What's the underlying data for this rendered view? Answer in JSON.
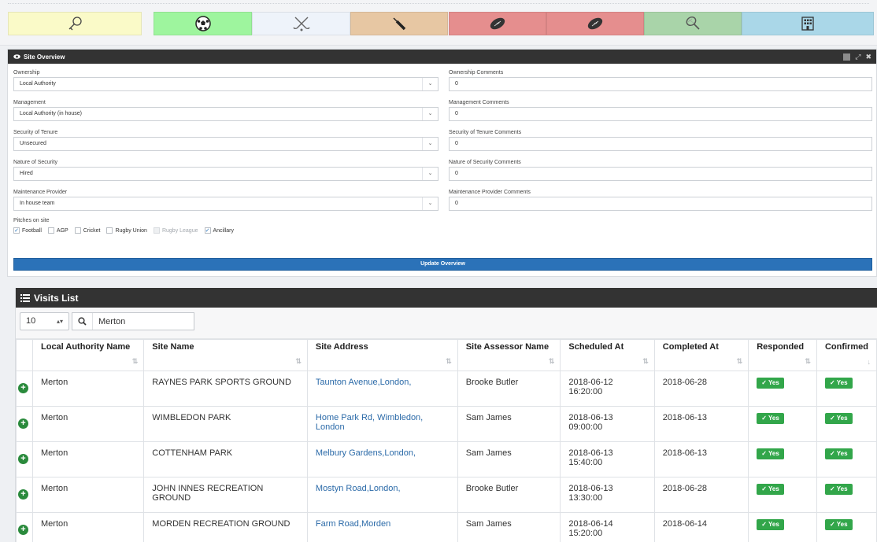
{
  "sport_tiles": [
    {
      "icon": "key-icon",
      "color": "#fafac8"
    },
    {
      "icon": "football-icon",
      "color": "#9ef59e"
    },
    {
      "icon": "hockey-sticks-icon",
      "color": "#eef3fa"
    },
    {
      "icon": "cricket-bat-icon",
      "color": "#e7c7a3"
    },
    {
      "icon": "rugby-ball-icon",
      "color": "#e58e8e"
    },
    {
      "icon": "rugby-ball-icon",
      "color": "#e58e8e"
    },
    {
      "icon": "tennis-racket-icon",
      "color": "#a9d4a9"
    },
    {
      "icon": "building-icon",
      "color": "#aad7e8"
    }
  ],
  "overview": {
    "title": "Site Overview",
    "left_fields": [
      {
        "label": "Ownership",
        "value": "Local Authority"
      },
      {
        "label": "Management",
        "value": "Local Authority (in house)"
      },
      {
        "label": "Security of Tenure",
        "value": "Unsecured"
      },
      {
        "label": "Nature of Security",
        "value": "Hired"
      },
      {
        "label": "Maintenance Provider",
        "value": "In house team"
      }
    ],
    "right_fields": [
      {
        "label": "Ownership Comments",
        "value": "0"
      },
      {
        "label": "Management Comments",
        "value": "0"
      },
      {
        "label": "Security of Tenure Comments",
        "value": "0"
      },
      {
        "label": "Nature of Security Comments",
        "value": "0"
      },
      {
        "label": "Maintenance Provider Comments",
        "value": "0"
      }
    ],
    "pitches_label": "Pitches on site",
    "pitches": [
      {
        "label": "Football",
        "checked": true,
        "disabled": false
      },
      {
        "label": "AGP",
        "checked": false,
        "disabled": false
      },
      {
        "label": "Cricket",
        "checked": false,
        "disabled": false
      },
      {
        "label": "Rugby Union",
        "checked": false,
        "disabled": false
      },
      {
        "label": "Rugby League",
        "checked": false,
        "disabled": true
      },
      {
        "label": "Ancillary",
        "checked": true,
        "disabled": false
      }
    ],
    "update_label": "Update Overview"
  },
  "visits": {
    "title": "Visits List",
    "page_size": "10",
    "search_value": "Merton",
    "columns": [
      "Local Authority Name",
      "Site Name",
      "Site Address",
      "Site Assessor Name",
      "Scheduled At",
      "Completed At",
      "Responded",
      "Confirmed"
    ],
    "rows": [
      [
        "Merton",
        "RAYNES PARK SPORTS GROUND",
        "Taunton Avenue,London,",
        "Brooke Butler",
        "2018-06-12 16:20:00",
        "2018-06-28",
        "✓ Yes",
        "✓ Yes"
      ],
      [
        "Merton",
        "WIMBLEDON PARK",
        "Home Park Rd, Wimbledon, London",
        "Sam James",
        "2018-06-13 09:00:00",
        "2018-06-13",
        "✓ Yes",
        "✓ Yes"
      ],
      [
        "Merton",
        "COTTENHAM PARK",
        "Melbury Gardens,London,",
        "Sam James",
        "2018-06-13 15:40:00",
        "2018-06-13",
        "✓ Yes",
        "✓ Yes"
      ],
      [
        "Merton",
        "JOHN INNES RECREATION GROUND",
        "Mostyn Road,London,",
        "Brooke Butler",
        "2018-06-13 13:30:00",
        "2018-06-28",
        "✓ Yes",
        "✓ Yes"
      ],
      [
        "Merton",
        "MORDEN RECREATION GROUND",
        "Farm Road,Morden",
        "Sam James",
        "2018-06-14 15:20:00",
        "2018-06-14",
        "✓ Yes",
        "✓ Yes"
      ]
    ]
  }
}
